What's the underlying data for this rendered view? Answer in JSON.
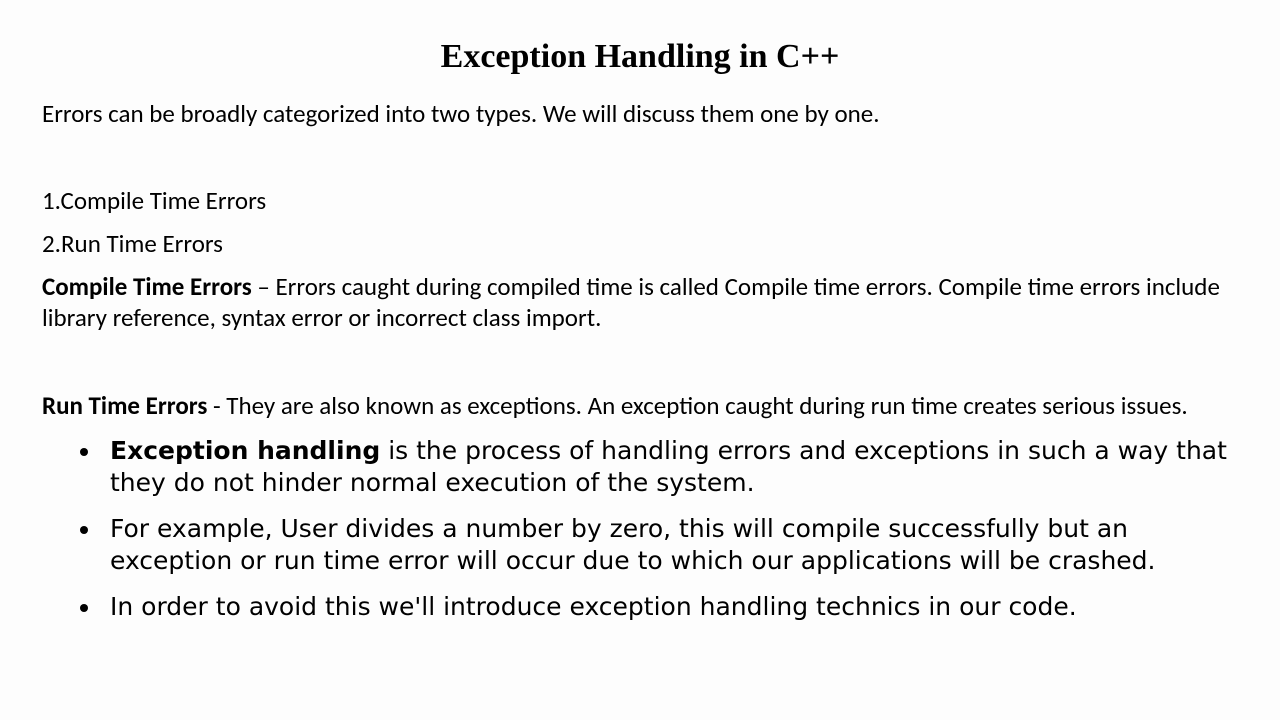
{
  "title": "Exception Handling in C++",
  "intro": "Errors can be broadly categorized into two types. We will discuss them one by one.",
  "list": {
    "item1": "1.Compile Time Errors",
    "item2": "2.Run Time Errors"
  },
  "compile": {
    "label": "Compile Time Errors",
    "text": " – Errors caught during compiled time is called Compile time errors. Compile time errors include library reference, syntax error or incorrect class import."
  },
  "runtime": {
    "label": "Run Time Errors",
    "text": " - They are also known as exceptions. An exception caught during run time creates serious issues."
  },
  "bullets": {
    "b1bold": "Exception handling",
    "b1rest": " is the process of handling errors and exceptions in such a way that they do not hinder normal execution of the system.",
    "b2": "For example, User divides a number by zero, this will compile successfully but an exception or run time error will occur due to which our applications will be crashed.",
    "b3": "In order to avoid this we'll introduce exception handling technics in our code."
  }
}
